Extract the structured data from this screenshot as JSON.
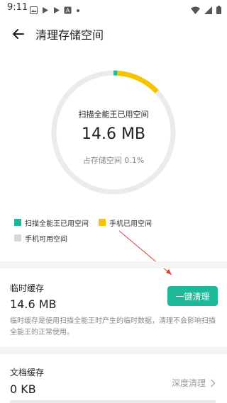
{
  "status_bar": {
    "time": "9:11",
    "left_icons": [
      "gallery-icon",
      "play-icon",
      "play-icon",
      "font-icon",
      "dot-icon"
    ],
    "right_icons": [
      "wifi-icon",
      "signal-icon",
      "battery-icon"
    ]
  },
  "header": {
    "title": "清理存储空间"
  },
  "storage_ring": {
    "label": "扫描全能王已用空间",
    "size": "14.6 MB",
    "percent_text": "占存储空间 0.1%",
    "used_by_app_fraction": 0.001,
    "used_by_phone_fraction": 0.12,
    "colors": {
      "app": "#1fb99a",
      "phone": "#f5c400",
      "free": "#ebebeb"
    }
  },
  "legend": [
    {
      "label": "扫描全能王已用空间",
      "color": "#1fb99a"
    },
    {
      "label": "手机已用空间",
      "color": "#f5c400"
    },
    {
      "label": "手机可用空间",
      "color": "#d9d9d9"
    }
  ],
  "temp_cache": {
    "title": "临时缓存",
    "size": "14.6 MB",
    "button_label": "一键清理",
    "description": "临时缓存是使用扫描全能王时产生的临时数据，清理不会影响扫描全能王的正常使用。"
  },
  "doc_cache": {
    "title": "文档缓存",
    "size": "0 KB",
    "action_label": "深度清理"
  },
  "annotation": {
    "arrow_color": "#e53935"
  }
}
